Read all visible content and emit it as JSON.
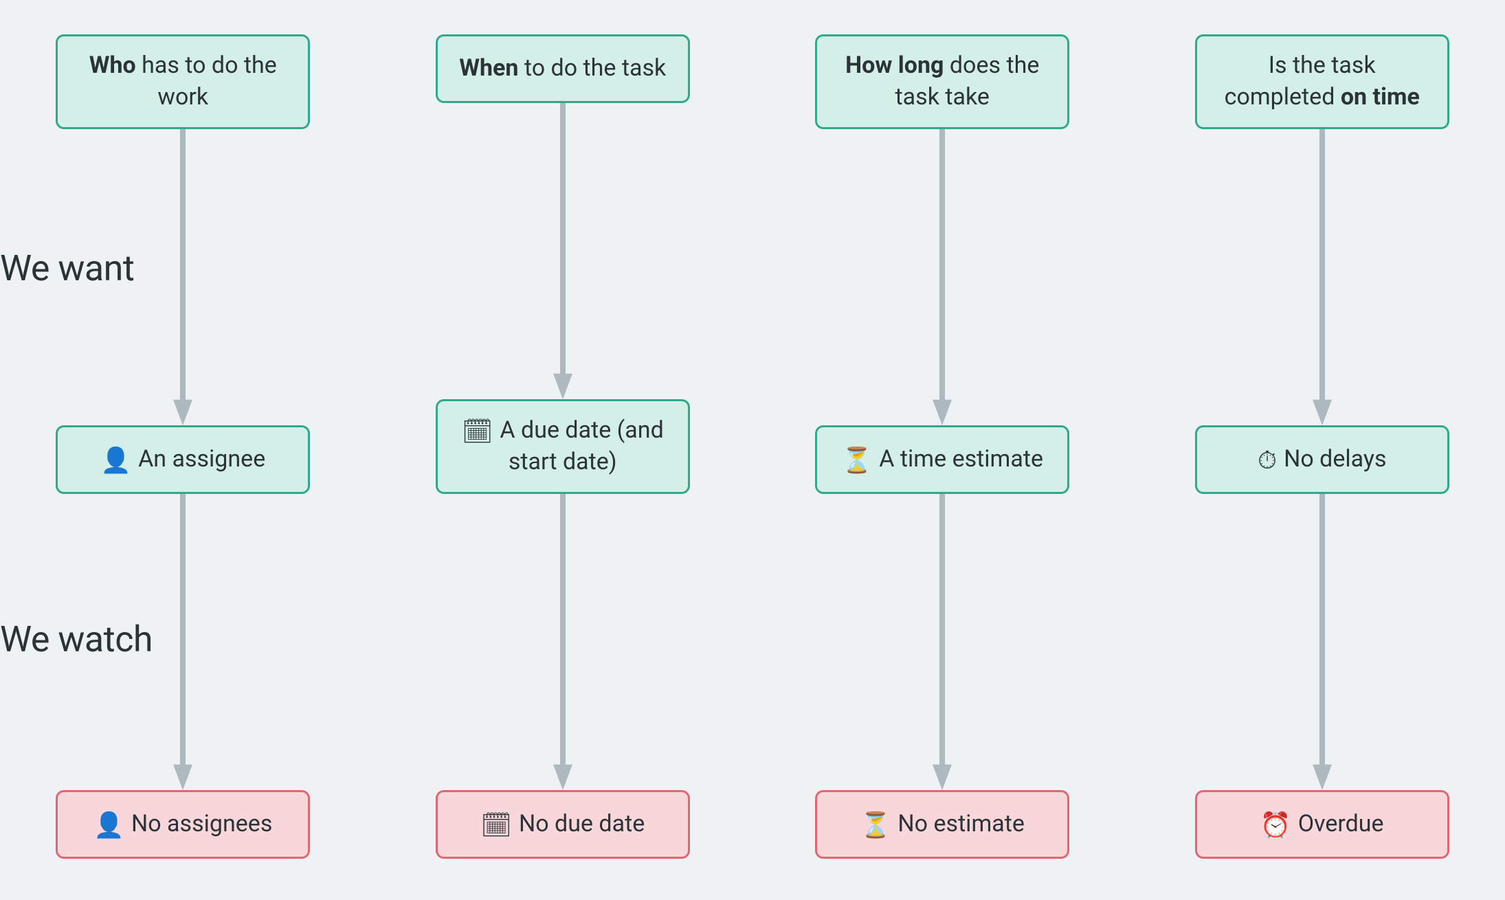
{
  "labels": {
    "we_want": "We want",
    "we_watch": "We watch"
  },
  "columns": [
    {
      "question_html": "<strong>Who</strong> has to do the work",
      "want": {
        "icon": "👤",
        "text": "An assignee"
      },
      "watch": {
        "icon": "👤",
        "text": "No assignees"
      }
    },
    {
      "question_html": "<strong>When</strong> to do the task",
      "want": {
        "icon": "🗓",
        "text": "A due date (and start date)"
      },
      "watch": {
        "icon": "🗓",
        "text": "No due date"
      }
    },
    {
      "question_html": "<strong>How long</strong> does the task take",
      "want": {
        "icon": "⏳",
        "text": "A time estimate"
      },
      "watch": {
        "icon": "⏳",
        "text": "No estimate"
      }
    },
    {
      "question_html": "Is the task completed <strong>on time</strong>",
      "want": {
        "icon": "⏱",
        "text": "No delays"
      },
      "watch": {
        "icon": "⏰",
        "text": "Overdue"
      }
    }
  ],
  "colors": {
    "green_bg": "#d4efe7",
    "green_border": "#2ea98b",
    "red_bg": "#f7d7da",
    "red_border": "#e06771",
    "arrow": "#aeb9bf",
    "page_bg": "#eef2f4",
    "text": "#2c3338"
  }
}
